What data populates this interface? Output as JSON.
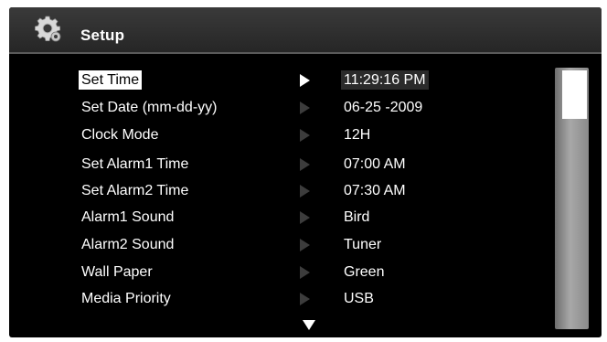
{
  "header": {
    "title": "Setup",
    "icon": "gear-icon"
  },
  "menu": {
    "items": [
      {
        "label": "Set Time",
        "value": "11:29:16 PM",
        "selected": true
      },
      {
        "label": "Set Date (mm-dd-yy)",
        "value": "06-25 -2009",
        "selected": false
      },
      {
        "label": "Clock Mode",
        "value": "12H",
        "selected": false
      },
      {
        "label": "Set Alarm1 Time",
        "value": "07:00 AM",
        "selected": false
      },
      {
        "label": "Set Alarm2 Time",
        "value": "07:30 AM",
        "selected": false
      },
      {
        "label": "Alarm1 Sound",
        "value": "Bird",
        "selected": false
      },
      {
        "label": "Alarm2 Sound",
        "value": "Tuner",
        "selected": false
      },
      {
        "label": "Wall Paper",
        "value": "Green",
        "selected": false
      },
      {
        "label": "Media Priority",
        "value": "USB",
        "selected": false
      }
    ]
  },
  "colors": {
    "background": "#000000",
    "text": "#ffffff",
    "inactive_arrow": "#3c3c3c"
  },
  "scroll": {
    "icon": "scroll-down-arrow-icon"
  }
}
